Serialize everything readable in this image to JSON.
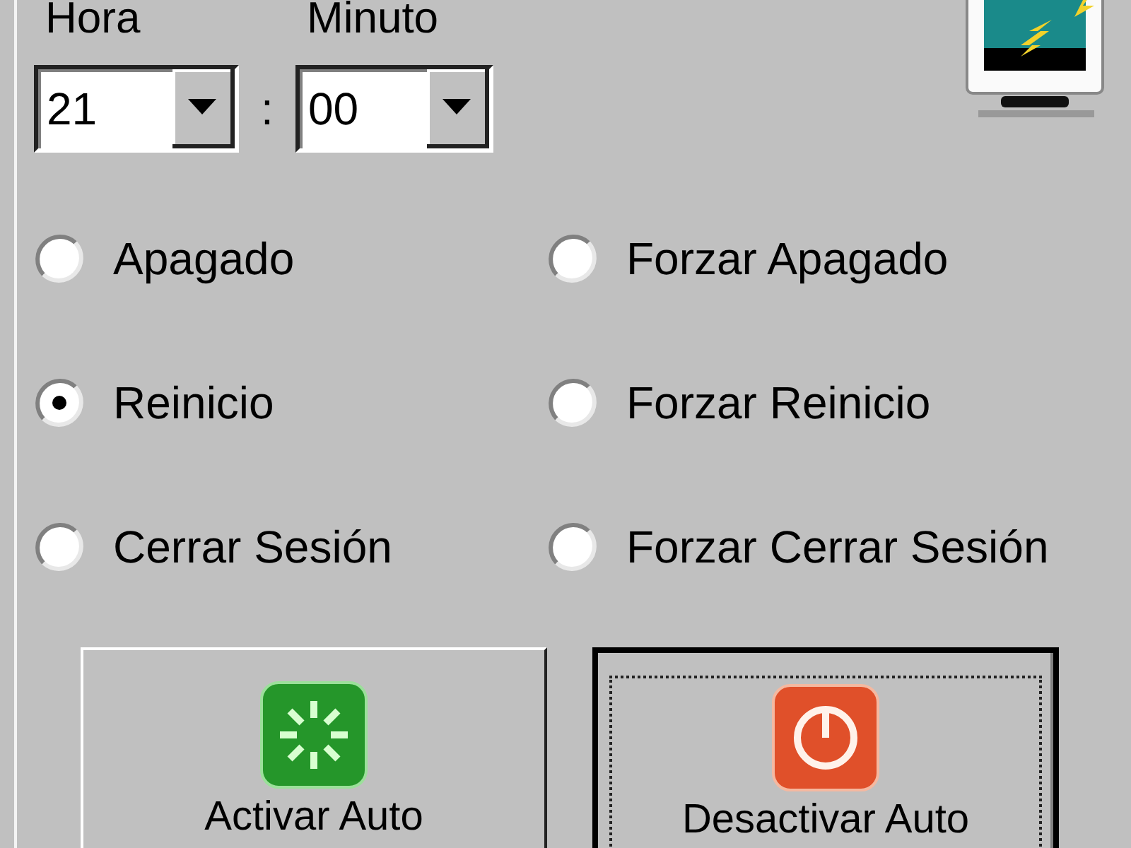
{
  "time": {
    "hour_label": "Hora",
    "minute_label": "Minuto",
    "hour": "21",
    "separator": ":",
    "minute": "00"
  },
  "options": [
    {
      "label": "Apagado",
      "selected": false
    },
    {
      "label": "Forzar Apagado",
      "selected": false
    },
    {
      "label": "Reinicio",
      "selected": true
    },
    {
      "label": "Forzar Reinicio",
      "selected": false
    },
    {
      "label": "Cerrar Sesión",
      "selected": false
    },
    {
      "label": "Forzar Cerrar Sesión",
      "selected": false
    }
  ],
  "buttons": [
    {
      "label": "Activar Auto",
      "kind": "start",
      "focused": false
    },
    {
      "label": "Desactivar Auto",
      "kind": "stop",
      "focused": true
    }
  ]
}
